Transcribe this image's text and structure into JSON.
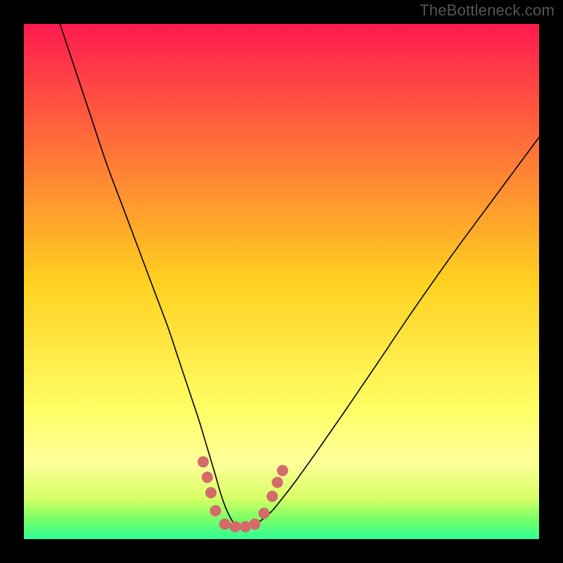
{
  "watermark": "TheBottleneck.com",
  "chart_data": {
    "type": "line",
    "title": "",
    "xlabel": "",
    "ylabel": "",
    "xlim": [
      0,
      100
    ],
    "ylim": [
      0,
      100
    ],
    "grid": false,
    "legend": false,
    "background_gradient": {
      "orientation": "vertical",
      "stops": [
        {
          "offset": 0.0,
          "color": "#ff1a4f"
        },
        {
          "offset": 0.5,
          "color": "#ffd020"
        },
        {
          "offset": 0.75,
          "color": "#ffff66"
        },
        {
          "offset": 0.85,
          "color": "#ffff9a"
        },
        {
          "offset": 0.92,
          "color": "#d8ff66"
        },
        {
          "offset": 0.96,
          "color": "#7cff66"
        },
        {
          "offset": 1.0,
          "color": "#2dff95"
        }
      ]
    },
    "series": [
      {
        "name": "bottleneck-curve",
        "stroke": "#000000",
        "width": 1.6,
        "x": [
          7,
          10,
          13,
          16,
          19,
          22,
          25,
          28,
          30,
          32,
          34,
          35.5,
          37,
          38,
          39,
          40,
          40.8,
          41.5,
          42.5,
          44,
          46,
          48,
          50,
          53,
          57,
          62,
          68,
          75,
          83,
          92,
          100
        ],
        "y": [
          100,
          91,
          82,
          73,
          65,
          57,
          49,
          41,
          35,
          29,
          23,
          18,
          13,
          9.5,
          6.5,
          4.3,
          3,
          2.4,
          2.3,
          2.6,
          3.6,
          5.3,
          7.7,
          11.6,
          17.2,
          24.4,
          33.2,
          43.6,
          55,
          67.2,
          78
        ]
      }
    ],
    "overlay_markers": {
      "name": "optimal-zone",
      "color": "#d46a6a",
      "points": [
        {
          "x": 34.8,
          "y": 15.0
        },
        {
          "x": 35.6,
          "y": 12.0
        },
        {
          "x": 36.3,
          "y": 9.0
        },
        {
          "x": 37.2,
          "y": 5.5
        },
        {
          "x": 39.0,
          "y": 2.9
        },
        {
          "x": 41.0,
          "y": 2.4
        },
        {
          "x": 43.0,
          "y": 2.4
        },
        {
          "x": 44.8,
          "y": 2.9
        },
        {
          "x": 46.6,
          "y": 5.0
        },
        {
          "x": 48.2,
          "y": 8.3
        },
        {
          "x": 49.2,
          "y": 11.0
        },
        {
          "x": 50.2,
          "y": 13.3
        }
      ],
      "radius": 8
    }
  }
}
